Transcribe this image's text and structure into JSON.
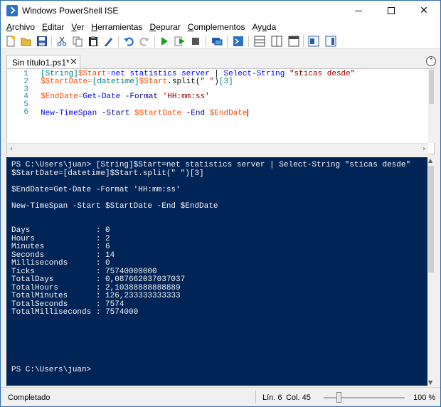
{
  "window": {
    "title": "Windows PowerShell ISE"
  },
  "menu": [
    {
      "label": "Archivo",
      "accel": "A",
      "rest": "rchivo"
    },
    {
      "label": "Editar",
      "accel": "E",
      "rest": "ditar"
    },
    {
      "label": "Ver",
      "accel": "V",
      "rest": "er"
    },
    {
      "label": "Herramientas",
      "accel": "H",
      "rest": "erramientas"
    },
    {
      "label": "Depurar",
      "accel": "D",
      "rest": "epurar"
    },
    {
      "label": "Complementos",
      "accel": "C",
      "rest": "omplementos"
    },
    {
      "label": "Ayuda",
      "pre": "Ay",
      "accel": "u",
      "rest": "da"
    }
  ],
  "toolbar_icons": [
    "new-script-icon",
    "open-icon",
    "save-icon",
    "cut-icon",
    "copy-icon",
    "paste-icon",
    "clear-console-icon",
    "undo-icon",
    "redo-icon",
    "run-script-icon",
    "run-selection-icon",
    "stop-icon",
    "remote-powershell-icon",
    "powershell-console-icon",
    "script-pane-top-icon",
    "script-pane-right-icon",
    "script-pane-maximized-icon",
    "show-command-icon",
    "command-addon-icon"
  ],
  "tab": {
    "label": "Sin título1.ps1*",
    "close": "✕"
  },
  "editor": {
    "lines": [
      {
        "num": "1",
        "tokens": [
          [
            "c-type",
            "[String]"
          ],
          [
            "c-var",
            "$Start"
          ],
          [
            "c-op",
            "="
          ],
          [
            "c-cmd",
            "net"
          ],
          [
            "c-cmd",
            " statistics"
          ],
          [
            "c-cmd",
            " server"
          ],
          [
            "c-plain",
            " | "
          ],
          [
            "c-cmd",
            "Select-String"
          ],
          [
            "c-plain",
            " "
          ],
          [
            "c-str",
            "\"sticas desde\""
          ]
        ]
      },
      {
        "num": "2",
        "tokens": [
          [
            "c-var",
            "$StartDate"
          ],
          [
            "c-op",
            "="
          ],
          [
            "c-type",
            "[datetime]"
          ],
          [
            "c-var",
            "$Start"
          ],
          [
            "c-plain",
            ".split("
          ],
          [
            "c-str",
            "\" \""
          ],
          [
            "c-plain",
            ")"
          ],
          [
            "c-type",
            "[3]"
          ]
        ]
      },
      {
        "num": "3",
        "tokens": []
      },
      {
        "num": "4",
        "tokens": [
          [
            "c-var",
            "$EndDate"
          ],
          [
            "c-op",
            "="
          ],
          [
            "c-cmd",
            "Get-Date"
          ],
          [
            "c-plain",
            " "
          ],
          [
            "c-param",
            "-Format"
          ],
          [
            "c-plain",
            " "
          ],
          [
            "c-str",
            "'HH:mm:ss'"
          ]
        ]
      },
      {
        "num": "5",
        "tokens": []
      },
      {
        "num": "6",
        "tokens": [
          [
            "c-cmd",
            "New-TimeSpan"
          ],
          [
            "c-plain",
            " "
          ],
          [
            "c-param",
            "-Start"
          ],
          [
            "c-plain",
            " "
          ],
          [
            "c-var",
            "$StartDate"
          ],
          [
            "c-plain",
            " "
          ],
          [
            "c-param",
            "-End"
          ],
          [
            "c-plain",
            " "
          ],
          [
            "c-var",
            "$EndDate"
          ]
        ],
        "cursor": true
      }
    ]
  },
  "console": {
    "lines": [
      "PS C:\\Users\\juan> [String]$Start=net statistics server | Select-String \"sticas desde\"",
      "$StartDate=[datetime]$Start.split(\" \")[3]",
      "",
      "$EndDate=Get-Date -Format 'HH:mm:ss'",
      "",
      "New-TimeSpan -Start $StartDate -End $EndDate",
      "",
      "",
      "Days              : 0",
      "Hours             : 2",
      "Minutes           : 6",
      "Seconds           : 14",
      "Milliseconds      : 0",
      "Ticks             : 75740000000",
      "TotalDays         : 0,087662037037037",
      "TotalHours        : 2,10388888888889",
      "TotalMinutes      : 126,233333333333",
      "TotalSeconds      : 7574",
      "TotalMilliseconds : 7574000",
      "",
      "",
      "",
      "",
      "",
      "",
      "PS C:\\Users\\juan>"
    ]
  },
  "status": {
    "text": "Completado",
    "line": "Lín. 6",
    "col": "Col. 45",
    "zoom": "100 %",
    "zoom_fraction": 0.19
  },
  "colors": {
    "console_bg": "#012456",
    "accent": "#2a72c8"
  }
}
